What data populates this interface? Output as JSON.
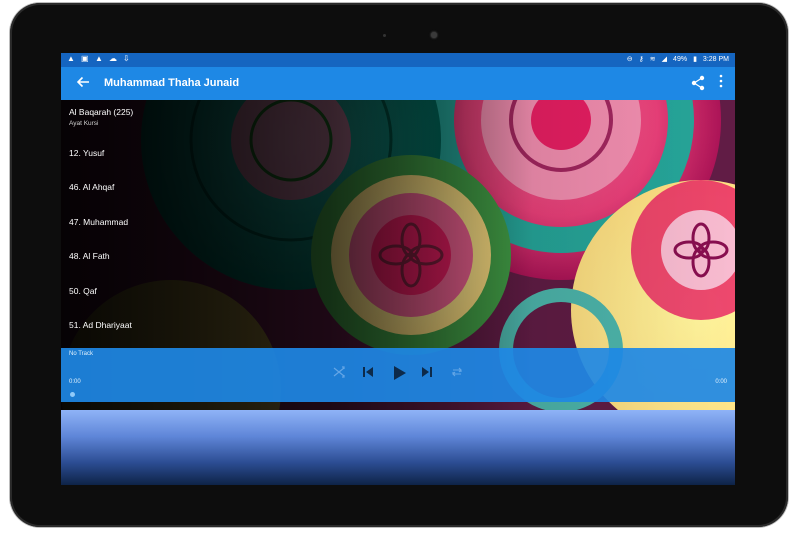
{
  "status_bar": {
    "battery": "49%",
    "time": "3:28 PM",
    "left_icons": [
      "notification-icon",
      "image-icon",
      "notification-icon",
      "cloud-icon",
      "download-icon"
    ],
    "right_icons": [
      "dnd-icon",
      "key-icon",
      "wifi-icon",
      "signal-icon",
      "battery-icon"
    ]
  },
  "app_bar": {
    "title": "Muhammad Thaha Junaid",
    "back_icon": "back-arrow-icon",
    "share_icon": "share-icon",
    "more_icon": "more-vert-icon"
  },
  "tracks": [
    {
      "label": "Al Baqarah (225)",
      "subtitle": "Ayat Kursi"
    },
    {
      "label": "12. Yusuf"
    },
    {
      "label": "46. Al Ahqaf"
    },
    {
      "label": "47. Muhammad"
    },
    {
      "label": "48. Al Fath"
    },
    {
      "label": "50. Qaf"
    },
    {
      "label": "51. Ad Dhariyaat"
    }
  ],
  "player": {
    "track_name": "No Track",
    "elapsed": "0:00",
    "duration": "0:00",
    "progress": 0,
    "controls": [
      "shuffle-icon",
      "previous-icon",
      "play-icon",
      "next-icon",
      "repeat-icon"
    ]
  },
  "colors": {
    "primary": "#1e88e5",
    "primary_dark": "#1565c0",
    "player_bg": "#1e88e5",
    "control_active": "#0d2a4a",
    "control_inactive": "#64a6e6"
  }
}
